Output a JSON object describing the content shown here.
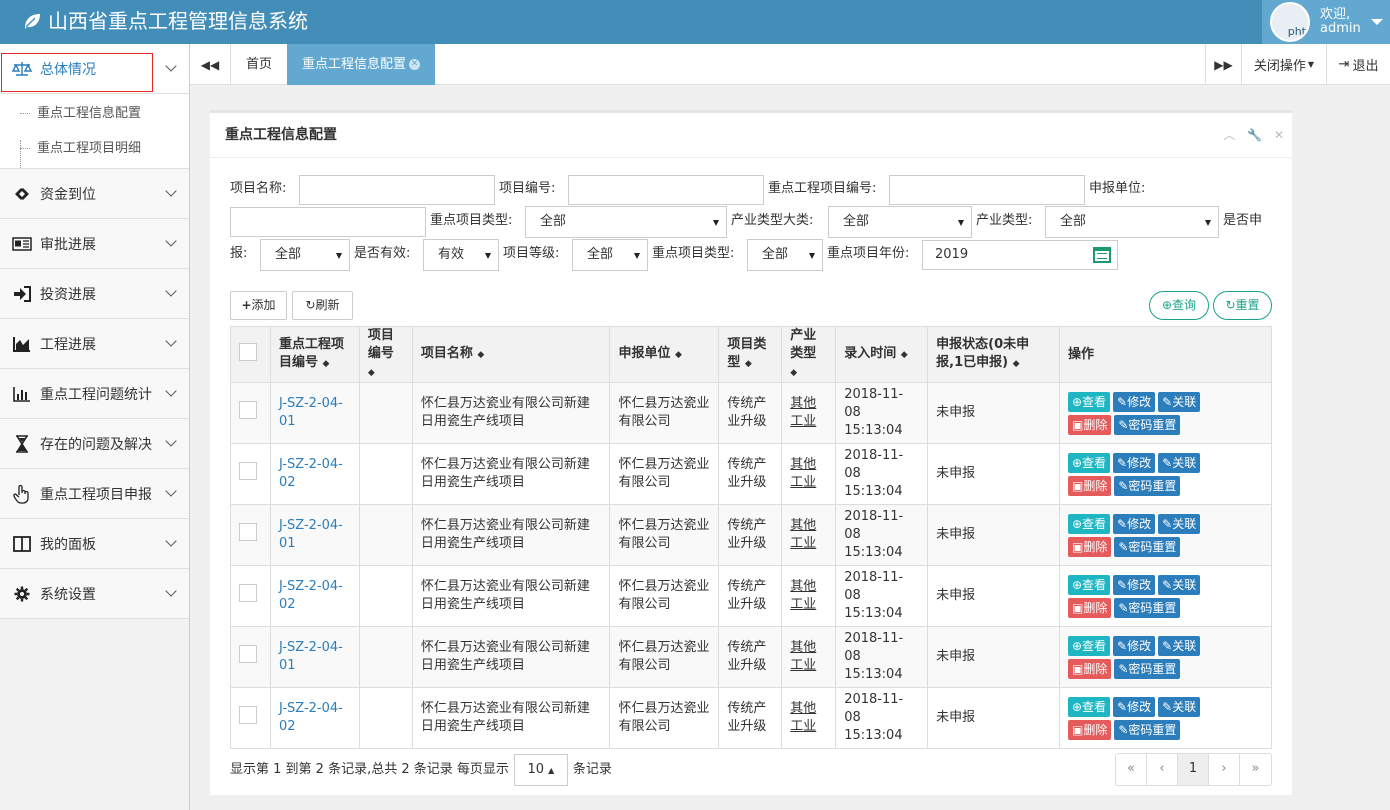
{
  "app": {
    "title": "山西省重点工程管理信息系统",
    "welcome": "欢迎,",
    "user": "admin",
    "avatar_alt": "pht"
  },
  "sidebar": {
    "items": [
      {
        "label": "总体情况",
        "icon": "scale-icon"
      },
      {
        "label": "资金到位",
        "icon": "money-icon"
      },
      {
        "label": "审批进展",
        "icon": "newspaper-icon"
      },
      {
        "label": "投资进展",
        "icon": "signin-icon"
      },
      {
        "label": "工程进展",
        "icon": "area-chart-icon"
      },
      {
        "label": "重点工程问题统计",
        "icon": "bar-chart-icon"
      },
      {
        "label": "存在的问题及解决",
        "icon": "hourglass-icon"
      },
      {
        "label": "重点工程项目申报",
        "icon": "hand-pointer-icon"
      },
      {
        "label": "我的面板",
        "icon": "columns-icon"
      },
      {
        "label": "系统设置",
        "icon": "gear-icon"
      }
    ],
    "submenu": [
      "重点工程信息配置",
      "重点工程项目明细"
    ]
  },
  "tabs": {
    "home": "首页",
    "active": "重点工程信息配置",
    "close_ops": "关闭操作",
    "logout": "退出"
  },
  "panel": {
    "title": "重点工程信息配置"
  },
  "filters": {
    "project_name": "项目名称:",
    "project_no": "项目编号:",
    "key_project_no": "重点工程项目编号:",
    "report_unit": "申报单位:",
    "key_type": "重点项目类型:",
    "key_type_value": "全部",
    "industry_big": "产业类型大类:",
    "industry_big_value": "全部",
    "industry_type": "产业类型:",
    "industry_type_value": "全部",
    "is_reported_a": "是否申",
    "is_reported_b": "报:",
    "is_reported_value": "全部",
    "is_valid": "是否有效:",
    "is_valid_value": "有效",
    "level": "项目等级:",
    "level_value": "全部",
    "key_type2": "重点项目类型:",
    "key_type2_value": "全部",
    "year": "重点项目年份:",
    "year_value": "2019"
  },
  "toolbar": {
    "add": "添加",
    "refresh": "刷新",
    "query": "查询",
    "reset": "重置"
  },
  "table": {
    "headers": [
      "重点工程项目编号",
      "项目编号",
      "项目名称",
      "申报单位",
      "项目类型",
      "产业类型",
      "录入时间",
      "申报状态(0未申报,1已申报)",
      "操作"
    ],
    "rows": [
      {
        "code": "J-SZ-2-04-01",
        "proj_no": "",
        "name": "怀仁县万达瓷业有限公司新建日用瓷生产线项目",
        "unit": "怀仁县万达瓷业有限公司",
        "ptype": "传统产业升级",
        "itype": "其他工业",
        "time": "2018-11-08 15:13:04",
        "status": "未申报"
      },
      {
        "code": "J-SZ-2-04-02",
        "proj_no": "",
        "name": "怀仁县万达瓷业有限公司新建日用瓷生产线项目",
        "unit": "怀仁县万达瓷业有限公司",
        "ptype": "传统产业升级",
        "itype": "其他工业",
        "time": "2018-11-08 15:13:04",
        "status": "未申报"
      },
      {
        "code": "J-SZ-2-04-01",
        "proj_no": "",
        "name": "怀仁县万达瓷业有限公司新建日用瓷生产线项目",
        "unit": "怀仁县万达瓷业有限公司",
        "ptype": "传统产业升级",
        "itype": "其他工业",
        "time": "2018-11-08 15:13:04",
        "status": "未申报"
      },
      {
        "code": "J-SZ-2-04-02",
        "proj_no": "",
        "name": "怀仁县万达瓷业有限公司新建日用瓷生产线项目",
        "unit": "怀仁县万达瓷业有限公司",
        "ptype": "传统产业升级",
        "itype": "其他工业",
        "time": "2018-11-08 15:13:04",
        "status": "未申报"
      },
      {
        "code": "J-SZ-2-04-01",
        "proj_no": "",
        "name": "怀仁县万达瓷业有限公司新建日用瓷生产线项目",
        "unit": "怀仁县万达瓷业有限公司",
        "ptype": "传统产业升级",
        "itype": "其他工业",
        "time": "2018-11-08 15:13:04",
        "status": "未申报"
      },
      {
        "code": "J-SZ-2-04-02",
        "proj_no": "",
        "name": "怀仁县万达瓷业有限公司新建日用瓷生产线项目",
        "unit": "怀仁县万达瓷业有限公司",
        "ptype": "传统产业升级",
        "itype": "其他工业",
        "time": "2018-11-08 15:13:04",
        "status": "未申报"
      }
    ],
    "actions": {
      "view": "查看",
      "edit": "修改",
      "link": "关联",
      "del": "删除",
      "pwd": "密码重置"
    }
  },
  "footer": {
    "summary": "显示第 1 到第 2 条记录,总共 2 条记录 每页显示",
    "page_size": "10",
    "suffix": "条记录",
    "page": "1"
  },
  "colors": {
    "topbar": "#438eb9",
    "tab_active": "#62a8d1",
    "link": "#2b7dbc",
    "danger": "#e55b5b",
    "info": "#1fb6c4",
    "success": "#1aa38a"
  }
}
